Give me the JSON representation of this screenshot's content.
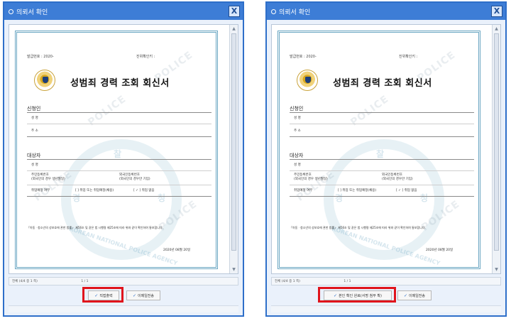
{
  "window": {
    "title": "의뢰서 확인",
    "close": "X"
  },
  "document": {
    "issue_no": "발급번호 : 2020-",
    "verify": "진위확인키 :",
    "title": "성범죄 경력 조회 회신서",
    "applicant": {
      "section": "신청인",
      "name": "성   명",
      "address": "주   소"
    },
    "subject": {
      "section": "대상자",
      "name": "성   명",
      "rrn": "주민등록번호",
      "rrn_sub": "(외국인의 경우 생년월일)",
      "foreign": "외국인등록번호",
      "foreign_sub": "(외국인의 경우만 기입)",
      "employ": "취업예정 여부",
      "opt1": "[   ] 취업 또는 취업예정(채용)",
      "opt2": "[ ✓ ] 취업 없음"
    },
    "notice": "「아동ㆍ청소년의 성보호에 관한 법률」 제56조 및 같은 법 시행령 제25조에 따라 위와 같이 확인하여 통보합니다.",
    "date": "2020년  08월  20일"
  },
  "watermark": {
    "top": "찰",
    "left": "경",
    "right": "청",
    "band": "KOREAN NATIONAL POLICE AGENCY",
    "police": "POLICE"
  },
  "footer": {
    "status": "전체 (4/4 중 1 쪽)",
    "pages": "1 / 1"
  },
  "buttons": {
    "left_primary": "직접출력",
    "right_primary": "본인 확인 완료(서명 첨부 확)",
    "secondary": "이메일전송"
  },
  "colors": {
    "highlight": "#e0141c",
    "accent": "#2e6fc9"
  }
}
